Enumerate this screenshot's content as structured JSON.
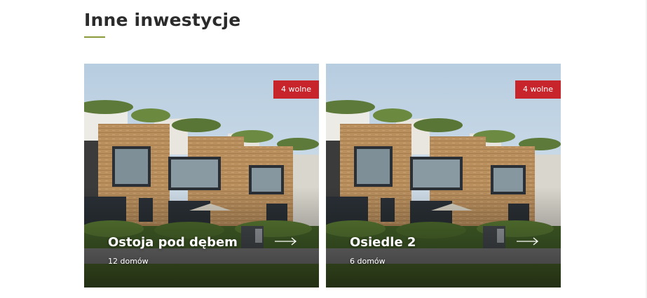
{
  "section": {
    "title": "Inne inwestycje"
  },
  "cards": [
    {
      "title": "Ostoja pod dębem",
      "count": "12 domów",
      "badge": "4 wolne",
      "image": "townhouse-photo",
      "arrow_icon": "arrow-right-icon"
    },
    {
      "title": "Osiedle 2",
      "count": "6 domów",
      "badge": "4 wolne",
      "image": "townhouse-photo",
      "arrow_icon": "arrow-right-icon"
    }
  ],
  "colors": {
    "accent": "#8a9a3b",
    "badge": "#c8242b",
    "title": "#2b2b2b"
  }
}
